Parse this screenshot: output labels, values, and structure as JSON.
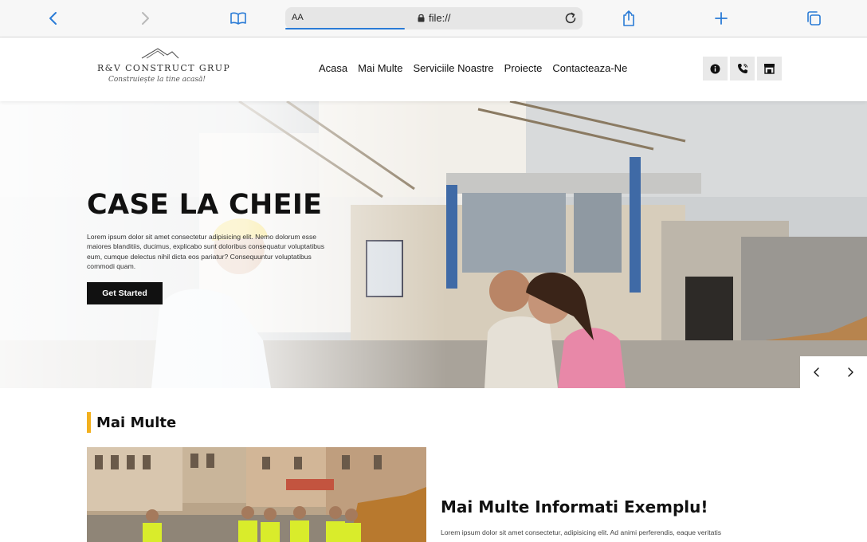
{
  "browser": {
    "text_size_label": "AA",
    "url": "file://"
  },
  "header": {
    "logo_brand": "R&V CONSTRUCT GRUP",
    "logo_tagline": "Construiește la tine acasă!",
    "nav": [
      "Acasa",
      "Mai Multe",
      "Serviciile Noastre",
      "Proiecte",
      "Contacteaza-Ne"
    ],
    "icons": [
      "info-icon",
      "phone-icon",
      "store-icon"
    ]
  },
  "hero": {
    "title": "CASE LA CHEIE",
    "text": "Lorem ipsum dolor sit amet consectetur adipisicing elit. Nemo dolorum esse maiores blanditiis, ducimus, explicabo sunt doloribus consequatur voluptatibus eum, cumque delectus nihil dicta eos pariatur? Consequuntur voluptatibus commodi quam.",
    "button_label": "Get Started"
  },
  "section": {
    "title": "Mai Multe",
    "info_title": "Mai Multe Informati Exemplu!",
    "info_text": "Lorem ipsum dolor sit amet consectetur, adipisicing elit. Ad animi perferendis, eaque veritatis"
  },
  "colors": {
    "accent": "#f2b01e",
    "button_bg": "#111111",
    "browser_blue": "#2a7bd6"
  }
}
